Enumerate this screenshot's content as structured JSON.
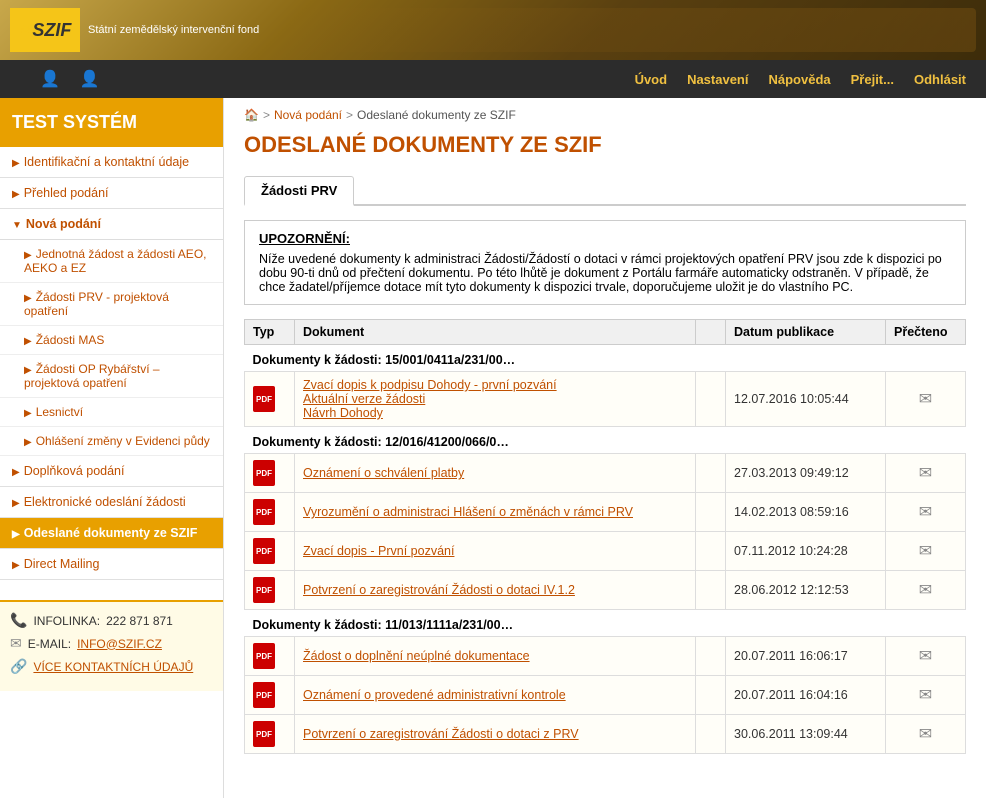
{
  "header": {
    "logo_text": "SZIF",
    "logo_subtitle": "Státní zemědělský intervenční fond",
    "logo_sun": "☀"
  },
  "navbar": {
    "icon1": "👤",
    "icon2": "👤",
    "links": [
      "Úvod",
      "Nastavení",
      "Nápověda",
      "Přejit...",
      "Odhlásit"
    ]
  },
  "sidebar": {
    "title": "TEST SYSTÉM",
    "items": [
      {
        "label": "Identifikační a kontaktní údaje",
        "icon": "▶",
        "active": false,
        "indent": false
      },
      {
        "label": "Přehled podání",
        "icon": "▶",
        "active": false,
        "indent": false
      },
      {
        "label": "Nová podání",
        "icon": "▼",
        "active": false,
        "indent": false
      },
      {
        "label": "Jednotná žádost a žádosti AEO, AEKO a EZ",
        "icon": "▶",
        "active": false,
        "indent": true
      },
      {
        "label": "Žádosti PRV - projektová opatření",
        "icon": "▶",
        "active": false,
        "indent": true
      },
      {
        "label": "Žádosti MAS",
        "icon": "▶",
        "active": false,
        "indent": true
      },
      {
        "label": "Žádosti OP Rybářství – projektová opatření",
        "icon": "▶",
        "active": false,
        "indent": true
      },
      {
        "label": "Lesnictví",
        "icon": "▶",
        "active": false,
        "indent": true
      },
      {
        "label": "Ohlášení změny v Evidenci půdy",
        "icon": "▶",
        "active": false,
        "indent": true
      },
      {
        "label": "Doplňková podání",
        "icon": "▶",
        "active": false,
        "indent": false
      },
      {
        "label": "Elektronické odeslání žádosti",
        "icon": "▶",
        "active": false,
        "indent": false
      },
      {
        "label": "Odeslané dokumenty ze SZIF",
        "icon": "▶",
        "active": true,
        "indent": false
      },
      {
        "label": "Direct Mailing",
        "icon": "▶",
        "active": false,
        "indent": false
      }
    ],
    "bottom": {
      "phone_icon": "📞",
      "phone_label": "INFOLINKA:",
      "phone_number": "222 871 871",
      "email_icon": "✉",
      "email_label": "E-MAIL:",
      "email_address": "INFO@SZIF.CZ",
      "link_icon": "🔗",
      "link_label": "VÍCE KONTAKTNÍCH ÚDAJŮ"
    }
  },
  "breadcrumb": {
    "home_icon": "🏠",
    "items": [
      "Nová podání",
      "Odeslané dokumenty ze SZIF"
    ]
  },
  "page": {
    "title": "ODESLANÉ DOKUMENTY ZE SZIF",
    "tab": "Žádosti PRV",
    "warning_title": "UPOZORNĚNÍ:",
    "warning_text": "Níže uvedené dokumenty k administraci Žádosti/Žádostí o dotaci v rámci projektových opatření PRV jsou zde k dispozici po dobu 90-ti dnů od přečtení dokumentu. Po této lhůtě je dokument z Portálu farmáře automaticky odstraněn. V případě, že chce žadatel/příjemce dotace mít tyto dokumenty k dispozici trvale, doporučujeme uložit je do vlastního PC."
  },
  "table": {
    "headers": [
      "Typ",
      "Dokument",
      "",
      "Datum publikace",
      "Přečteno"
    ],
    "groups": [
      {
        "group_label": "Dokumenty k žádosti: 15/001/0411a/231/00…",
        "rows": [
          {
            "links": [
              "Zvací dopis k podpisu Dohody - první pozvání",
              "Aktuální verze žádosti",
              "Návrh Dohody"
            ],
            "date": "12.07.2016 10:05:44",
            "read_icon": "✉"
          }
        ]
      },
      {
        "group_label": "Dokumenty k žádosti: 12/016/41200/066/0…",
        "rows": [
          {
            "links": [
              "Oznámení o schválení platby"
            ],
            "date": "27.03.2013 09:49:12",
            "read_icon": "✉"
          },
          {
            "links": [
              "Vyrozumění o administraci Hlášení o změnách v rámci PRV"
            ],
            "date": "14.02.2013 08:59:16",
            "read_icon": "✉"
          },
          {
            "links": [
              "Zvací dopis - První pozvání"
            ],
            "date": "07.11.2012 10:24:28",
            "read_icon": "✉"
          },
          {
            "links": [
              "Potvrzení o zaregistrování Žádosti o dotaci IV.1.2"
            ],
            "date": "28.06.2012 12:12:53",
            "read_icon": "✉"
          }
        ]
      },
      {
        "group_label": "Dokumenty k žádosti: 11/013/1111a/231/00…",
        "rows": [
          {
            "links": [
              "Žádost o doplnění neúplné dokumentace"
            ],
            "date": "20.07.2011 16:06:17",
            "read_icon": "✉"
          },
          {
            "links": [
              "Oznámení o provedené administrativní kontrole"
            ],
            "date": "20.07.2011 16:04:16",
            "read_icon": "✉"
          },
          {
            "links": [
              "Potvrzení o zaregistrování Žádosti o dotaci z PRV"
            ],
            "date": "30.06.2011 13:09:44",
            "read_icon": "✉"
          }
        ]
      }
    ]
  }
}
